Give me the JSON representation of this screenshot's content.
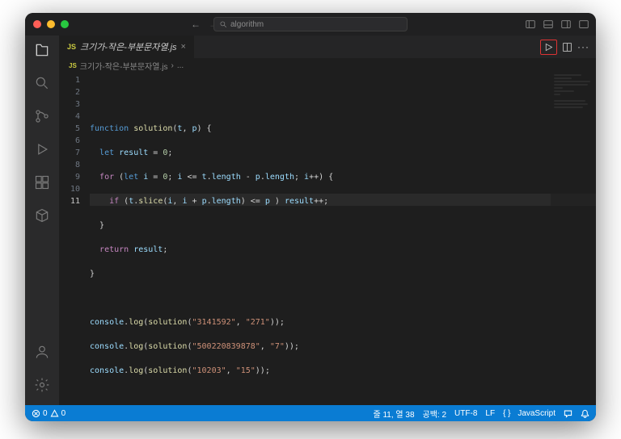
{
  "titlebar": {
    "search_placeholder": "algorithm"
  },
  "tab": {
    "badge": "JS",
    "filename": "크기가-작은-부분문자열.js",
    "close": "×"
  },
  "breadcrumb": {
    "badge": "JS",
    "file": "크기가-작은-부분문자열.js",
    "sep": "›",
    "rest": "..."
  },
  "code": {
    "lines": [
      1,
      2,
      3,
      4,
      5,
      6,
      7,
      8,
      9,
      10,
      11
    ],
    "highlight_line": 11,
    "l1": {
      "a": "function",
      "b": "solution",
      "c": "(",
      "d": "t",
      "e": ", ",
      "f": "p",
      "g": ") {"
    },
    "l2": {
      "a": "let",
      "b": "result",
      "c": " = ",
      "d": "0",
      "e": ";"
    },
    "l3": {
      "a": "for",
      "b": " (",
      "c": "let",
      "d": "i",
      "e": " = ",
      "f": "0",
      "g": "; ",
      "h": "i",
      "i": " <= ",
      "j": "t",
      "k": ".",
      "l": "length",
      "m": " - ",
      "n": "p",
      "o": ".",
      "p": "length",
      "q": "; ",
      "r": "i",
      "s": "++) {"
    },
    "l4": {
      "a": "if",
      "b": " (",
      "c": "t",
      "d": ".",
      "e": "slice",
      "f": "(",
      "g": "i",
      "h": ", ",
      "i": "i",
      "j": " + ",
      "k": "p",
      "l": ".",
      "m": "length",
      "n": ") <= ",
      "o": "p",
      "p": " ) ",
      "q": "result",
      "r": "++;"
    },
    "l5": {
      "a": "}"
    },
    "l6": {
      "a": "return",
      "b": "result",
      "c": ";"
    },
    "l7": {
      "a": "}"
    },
    "l9": {
      "a": "console",
      "b": ".",
      "c": "log",
      "d": "(",
      "e": "solution",
      "f": "(",
      "g": "\"3141592\"",
      "h": ", ",
      "i": "\"271\"",
      "j": "));"
    },
    "l10": {
      "a": "console",
      "b": ".",
      "c": "log",
      "d": "(",
      "e": "solution",
      "f": "(",
      "g": "\"500220839878\"",
      "h": ", ",
      "i": "\"7\"",
      "j": "));"
    },
    "l11": {
      "a": "console",
      "b": ".",
      "c": "log",
      "d": "(",
      "e": "solution",
      "f": "(",
      "g": "\"10203\"",
      "h": ", ",
      "i": "\"15\"",
      "j": "));"
    }
  },
  "status": {
    "errors": "0",
    "warnings": "0",
    "cursor": "줄 11, 열 38",
    "spaces": "공백: 2",
    "encoding": "UTF-8",
    "eol": "LF",
    "lang_brackets": "{ }",
    "language": "JavaScript"
  }
}
